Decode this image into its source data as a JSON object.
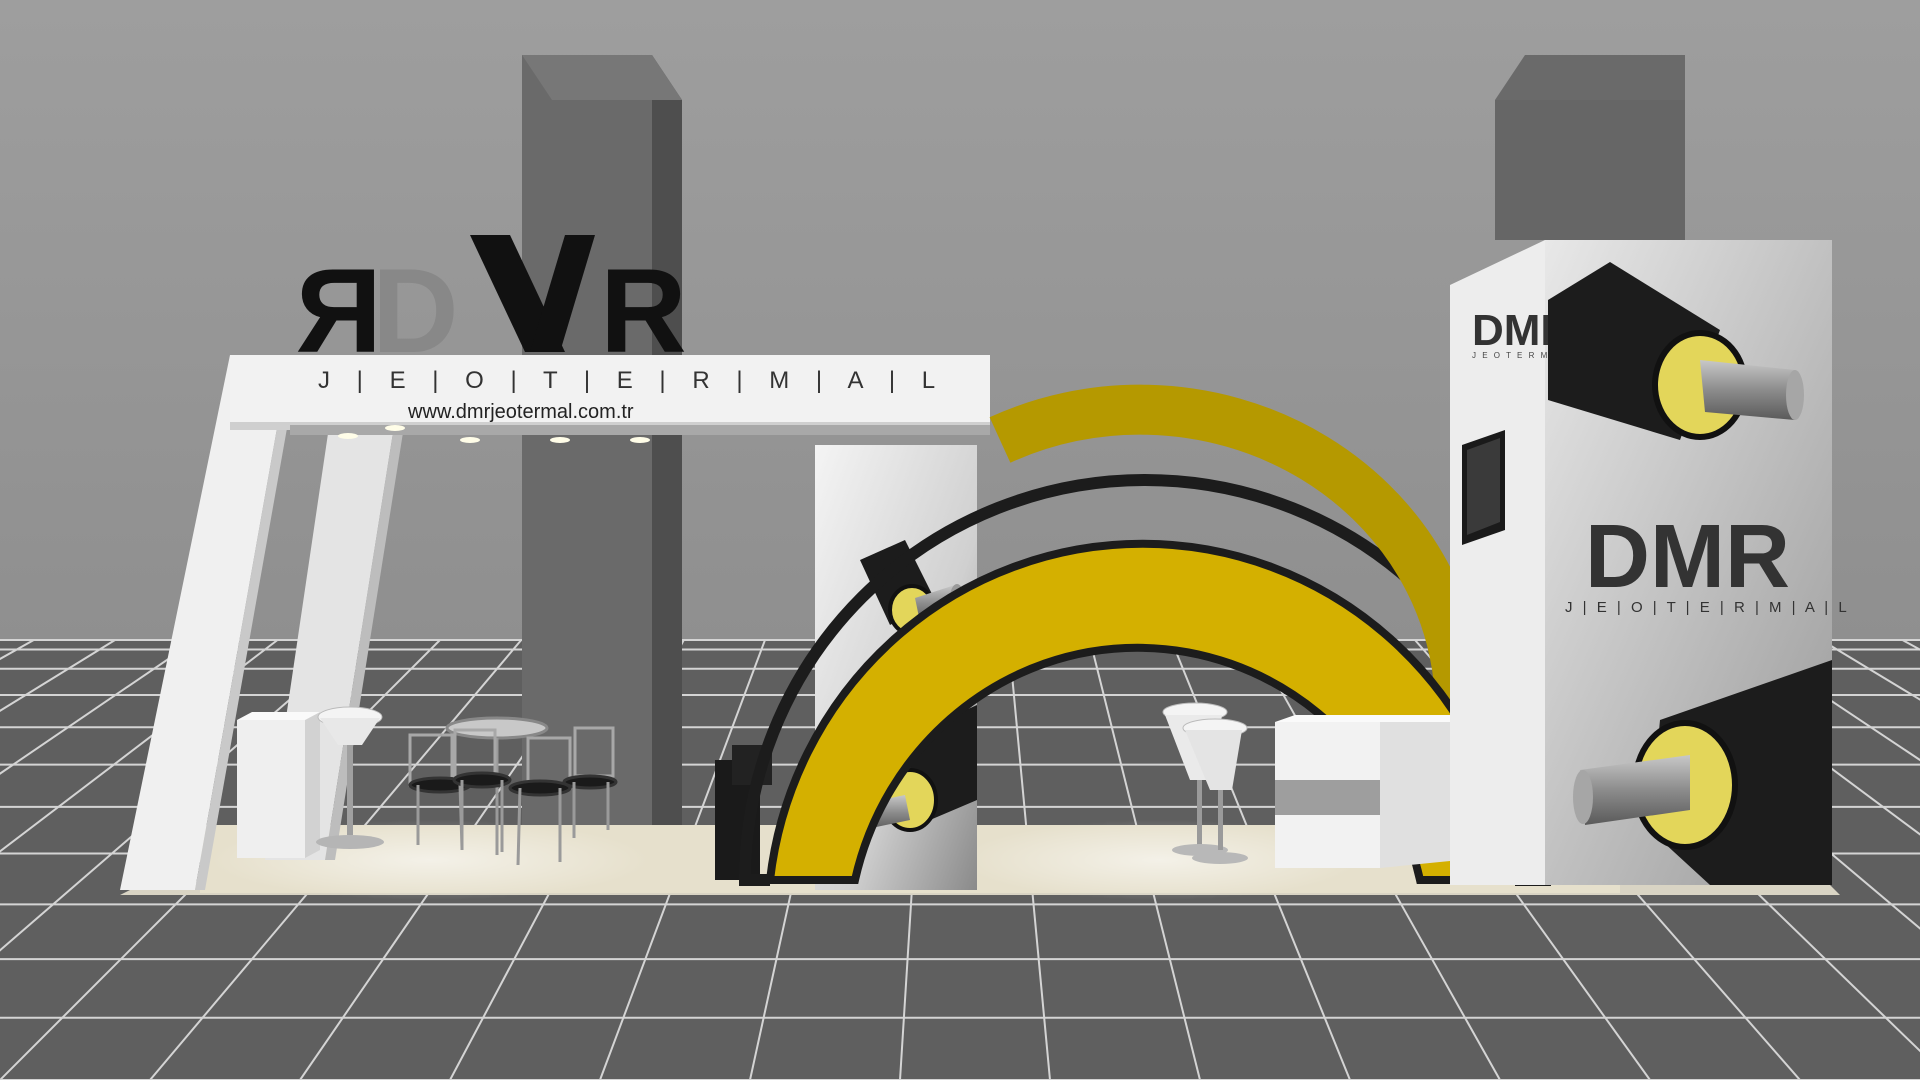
{
  "booth": {
    "brand_logo": "DMR",
    "brand_sub": "J E O T E R M A L",
    "brand_sub_spaced": "J | E | O | T | E | R | M | A | L",
    "website": "www.dmrjeotermal.com.tr"
  },
  "colors": {
    "background": "#9a9a9a",
    "floor": "#5f5f5f",
    "grid_lines": "#d8d8d8",
    "arch_yellow": "#d4b000",
    "arch_outline": "#1c1c1c",
    "white_structure": "#ececec",
    "pillar_dark": "#6b6b6b",
    "insulation_yellow": "#e3d65a",
    "pipe_black": "#1a1a1a"
  },
  "icons": {
    "pipe_graphic": "insulated-pipe-icon",
    "stool": "bar-stool-icon",
    "chair": "chair-icon"
  }
}
